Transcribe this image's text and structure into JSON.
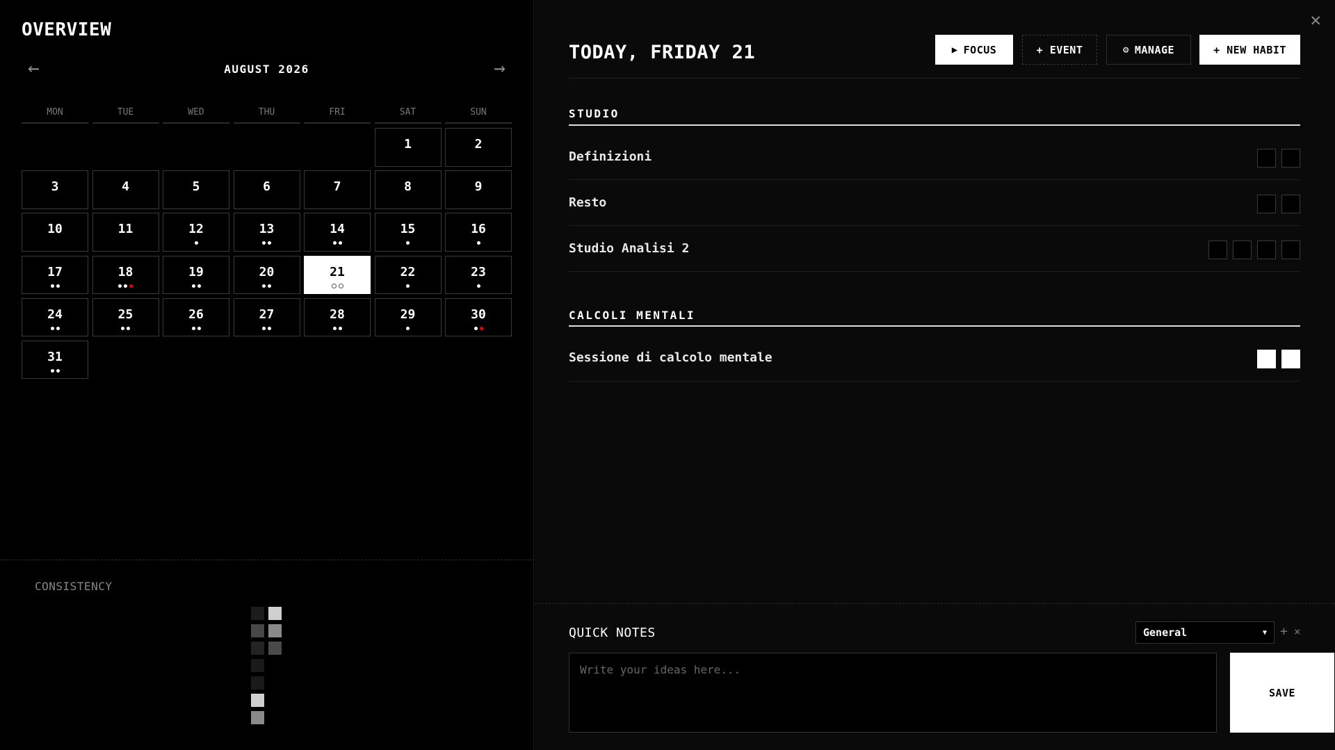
{
  "overview": {
    "title": "OVERVIEW",
    "prev_arrow": "←",
    "next_arrow": "→",
    "month_label": "AUGUST 2026",
    "weekdays": [
      "MON",
      "TUE",
      "WED",
      "THU",
      "FRI",
      "SAT",
      "SUN"
    ],
    "leading_blanks": 5,
    "days": [
      {
        "n": "1",
        "dots": []
      },
      {
        "n": "2",
        "dots": []
      },
      {
        "n": "3",
        "dots": []
      },
      {
        "n": "4",
        "dots": []
      },
      {
        "n": "5",
        "dots": []
      },
      {
        "n": "6",
        "dots": []
      },
      {
        "n": "7",
        "dots": []
      },
      {
        "n": "8",
        "dots": []
      },
      {
        "n": "9",
        "dots": []
      },
      {
        "n": "10",
        "dots": []
      },
      {
        "n": "11",
        "dots": []
      },
      {
        "n": "12",
        "dots": [
          "w"
        ]
      },
      {
        "n": "13",
        "dots": [
          "w",
          "w"
        ]
      },
      {
        "n": "14",
        "dots": [
          "w",
          "w"
        ]
      },
      {
        "n": "15",
        "dots": [
          "w"
        ]
      },
      {
        "n": "16",
        "dots": [
          "w"
        ]
      },
      {
        "n": "17",
        "dots": [
          "w",
          "w"
        ]
      },
      {
        "n": "18",
        "dots": [
          "w",
          "w",
          "r"
        ]
      },
      {
        "n": "19",
        "dots": [
          "w",
          "w"
        ]
      },
      {
        "n": "20",
        "dots": [
          "w",
          "w"
        ]
      },
      {
        "n": "21",
        "dots": [
          "o",
          "o"
        ],
        "today": true
      },
      {
        "n": "22",
        "dots": [
          "w"
        ]
      },
      {
        "n": "23",
        "dots": [
          "w"
        ]
      },
      {
        "n": "24",
        "dots": [
          "w",
          "w"
        ]
      },
      {
        "n": "25",
        "dots": [
          "w",
          "w"
        ]
      },
      {
        "n": "26",
        "dots": [
          "w",
          "w"
        ]
      },
      {
        "n": "27",
        "dots": [
          "w",
          "w"
        ]
      },
      {
        "n": "28",
        "dots": [
          "w",
          "w"
        ]
      },
      {
        "n": "29",
        "dots": [
          "w"
        ]
      },
      {
        "n": "30",
        "dots": [
          "w",
          "r"
        ]
      },
      {
        "n": "31",
        "dots": [
          "w",
          "w"
        ]
      }
    ],
    "consistency_label": "CONSISTENCY",
    "consistency_colors": [
      "#1c1c1c",
      "#cfcfcf",
      "#474747",
      "#8a8a8a",
      "#232323",
      "#4a4a4a",
      "#1a1a1a",
      "#1a1a1a",
      "#cfcfcf",
      "#8a8a8a"
    ]
  },
  "day": {
    "title": "TODAY, FRIDAY 21",
    "close_icon": "close-icon",
    "buttons": {
      "focus": "FOCUS",
      "event": "+ EVENT",
      "manage": "MANAGE",
      "new_habit": "+ NEW HABIT"
    },
    "sections": [
      {
        "title": "STUDIO",
        "habits": [
          {
            "name": "Definizioni",
            "checks": [
              false,
              false
            ]
          },
          {
            "name": "Resto",
            "checks": [
              false,
              false
            ]
          },
          {
            "name": "Studio Analisi 2",
            "checks": [
              false,
              false,
              false,
              false
            ]
          }
        ]
      },
      {
        "title": "CALCOLI MENTALI",
        "habits": [
          {
            "name": "Sessione di calcolo mentale",
            "checks": [
              true,
              true
            ]
          }
        ]
      }
    ]
  },
  "quick_notes": {
    "title": "QUICK NOTES",
    "category": "General",
    "add": "+",
    "remove": "×",
    "placeholder": "Write your ideas here...",
    "save": "SAVE"
  },
  "colors": {
    "accent_red": "#ee0000",
    "background": "#000000",
    "panel": "#0a0a0a"
  }
}
